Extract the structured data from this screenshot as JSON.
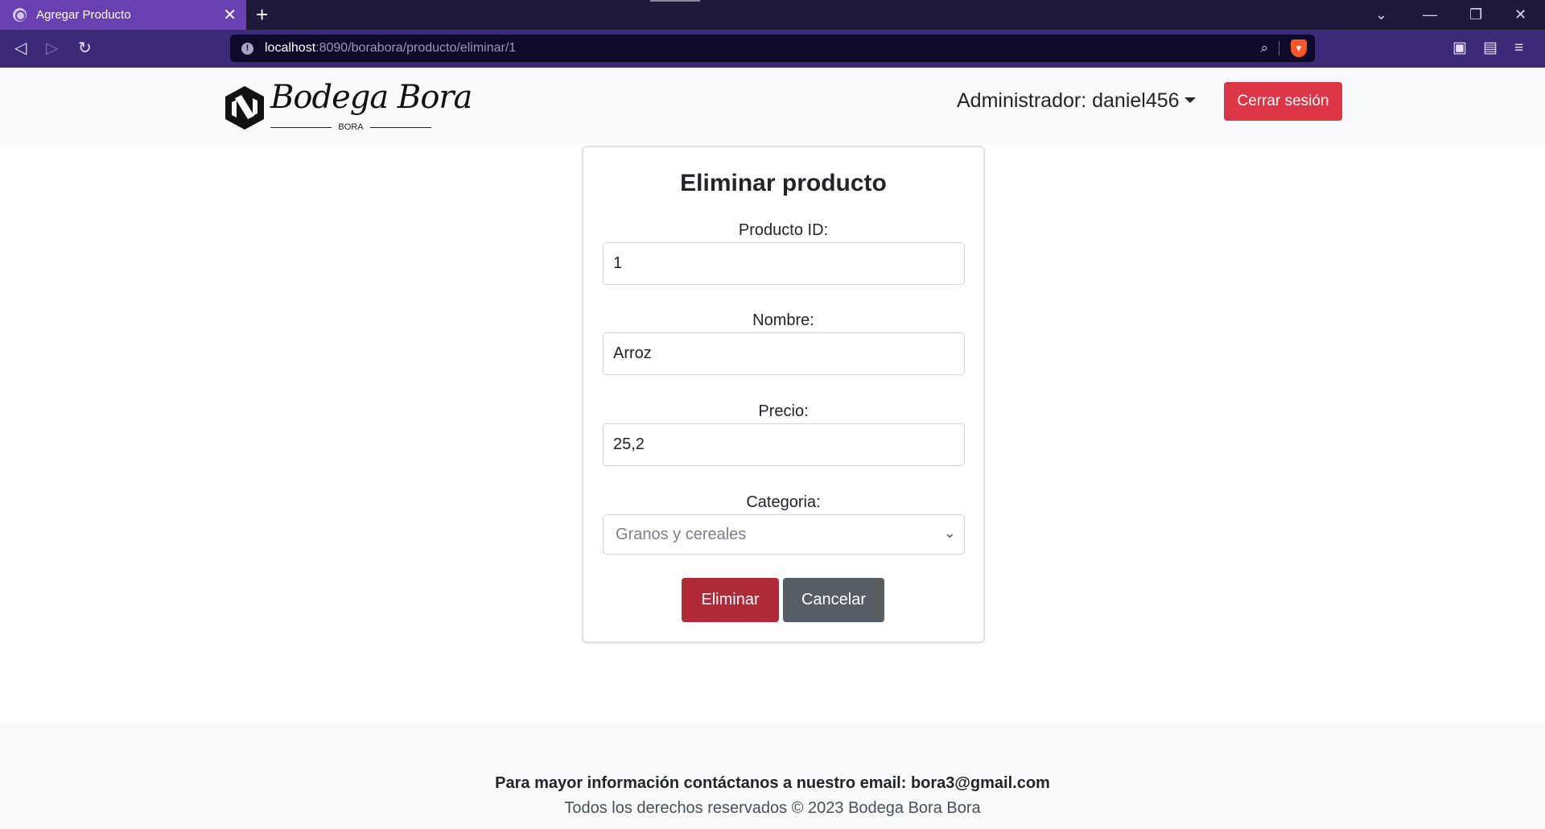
{
  "browser": {
    "tab_title": "Agregar Producto",
    "tab_close": "✕",
    "new_tab": "+",
    "url_host": "localhost",
    "url_path": ":8090/borabora/producto/eliminar/1"
  },
  "header": {
    "brand": "Bodega Bora",
    "tagline": "BORA",
    "admin_label": "Administrador: daniel456",
    "logout_label": "Cerrar sesión"
  },
  "form": {
    "title": "Eliminar producto",
    "id_label": "Producto ID:",
    "id_value": "1",
    "name_label": "Nombre:",
    "name_value": "Arroz",
    "price_label": "Precio:",
    "price_value": "25,2",
    "category_label": "Categoria:",
    "category_value": "Granos y cereales",
    "delete_label": "Eliminar",
    "cancel_label": "Cancelar"
  },
  "footer": {
    "contact": "Para mayor información contáctanos a nuestro email: bora3@gmail.com",
    "copyright": "Todos los derechos reservados © 2023 Bodega Bora Bora"
  },
  "colors": {
    "tab_active": "#6a3fb0",
    "toolbar": "#3b2a78",
    "danger": "#dc3545",
    "danger_dark": "#b02a37",
    "secondary": "#565e64"
  }
}
